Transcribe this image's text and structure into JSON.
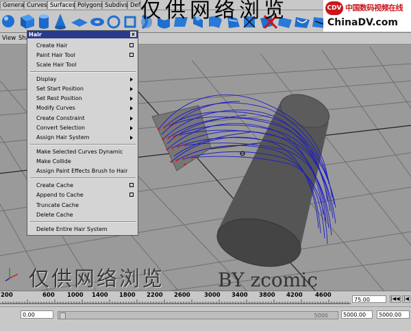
{
  "shelf_tabs": [
    "General",
    "Curves",
    "Surfaces",
    "Polygons",
    "Subdivs",
    "Def"
  ],
  "active_tab": "Surfaces",
  "shelf_icons": [
    "sphere-icon",
    "cube-icon",
    "cylinder-icon",
    "cone-icon",
    "plane-icon",
    "torus-icon",
    "circle-icon",
    "square-icon",
    "revolve-icon",
    "loft-icon",
    "planar-icon",
    "extrude-icon",
    "birail-icon",
    "boundary-icon",
    "square-surface-icon",
    "bevel-icon",
    "intersect-icon",
    "project-curve-icon",
    "trim-icon",
    "untrim-icon",
    "attach-icon",
    "detach-icon",
    "align-icon",
    "fillet-icon",
    "stitch-icon"
  ],
  "logo": {
    "badge": "CDV",
    "cn_text": "中国数码视频在线",
    "en_text": "ChinaDV.com"
  },
  "top_watermark": "仅供网络浏览",
  "viewport_menu": [
    "View",
    "Sha"
  ],
  "hair_menu": {
    "title": "Hair",
    "close": "x",
    "items": [
      {
        "label": "Create Hair",
        "option_box": true
      },
      {
        "label": "Paint Hair Tool",
        "option_box": true
      },
      {
        "label": "Scale Hair Tool"
      },
      {
        "label": "Display",
        "submenu": true
      },
      {
        "label": "Set Start Position",
        "submenu": true
      },
      {
        "label": "Set Rest Position",
        "submenu": true
      },
      {
        "label": "Modify Curves",
        "submenu": true
      },
      {
        "label": "Create Constraint",
        "submenu": true
      },
      {
        "label": "Convert Selection",
        "submenu": true
      },
      {
        "label": "Assign Hair System",
        "submenu": true
      },
      {
        "label": "Make Selected Curves Dynamic"
      },
      {
        "label": "Make Collide"
      },
      {
        "label": "Assign Paint Effects Brush to Hair"
      },
      {
        "label": "Create Cache",
        "option_box": true
      },
      {
        "label": "Append to Cache",
        "option_box": true
      },
      {
        "label": "Truncate Cache"
      },
      {
        "label": "Delete Cache"
      },
      {
        "label": "Delete Entire Hair System"
      }
    ]
  },
  "bottom_watermark": "仅供网络浏览",
  "watermark_credit": "BY zcomic",
  "timeline": {
    "ticks": [
      "200",
      "600",
      "1000",
      "1400",
      "1800",
      "2200",
      "2600",
      "3000",
      "3400",
      "3800",
      "4200",
      "4600"
    ],
    "current_time": "75.00",
    "playback_buttons": [
      "|◀◀",
      "|◀"
    ]
  },
  "range": {
    "start_field": "0.00",
    "slider_end_label": "5000",
    "end_field": "5000.00",
    "end_field2": "5000.00"
  },
  "colors": {
    "hair_curves": "#1a1acc",
    "menu_title_bg": "#2a3a8a",
    "viewport_bg": "#9a9a9a",
    "cylinder": "#555555",
    "plane": "#777777",
    "curve_points": "#cc2222"
  }
}
